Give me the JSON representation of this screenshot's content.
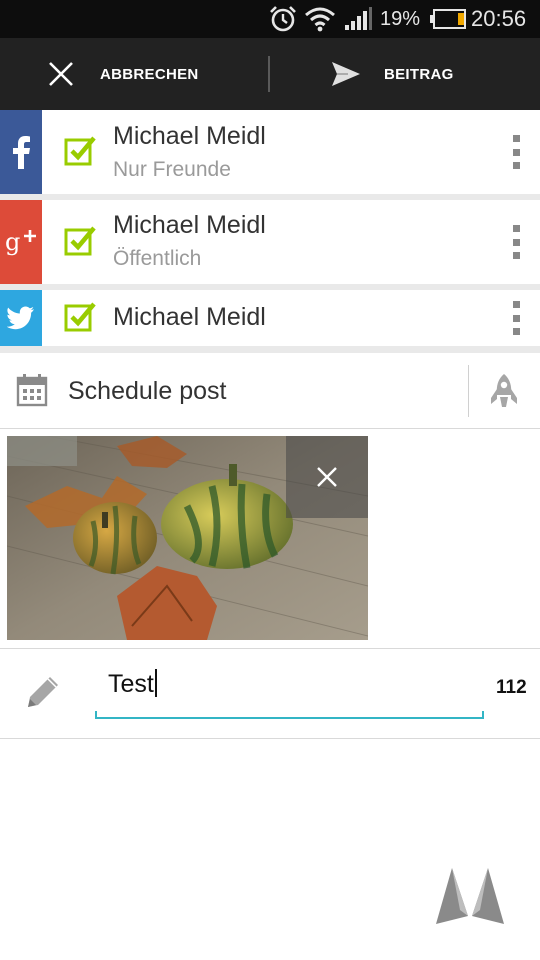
{
  "status_bar": {
    "icons": [
      "alarm-icon",
      "wifi-icon",
      "signal-icon"
    ],
    "battery_percent": "19%",
    "battery_level": 0.19,
    "time": "20:56"
  },
  "action_bar": {
    "cancel_label": "ABBRECHEN",
    "cancel_icon": "close-icon",
    "post_label": "BEITRAG",
    "post_icon": "send-icon"
  },
  "accounts": [
    {
      "network": "facebook",
      "network_icon": "facebook-icon",
      "color": "#3b5998",
      "checked": true,
      "name": "Michael Meidl",
      "audience": "Nur Freunde"
    },
    {
      "network": "google-plus",
      "network_icon": "google-plus-icon",
      "color": "#dd4b39",
      "checked": true,
      "name": "Michael Meidl",
      "audience": "Öffentlich"
    },
    {
      "network": "twitter",
      "network_icon": "twitter-icon",
      "color": "#2ea7e0",
      "checked": true,
      "name": "Michael Meidl"
    }
  ],
  "schedule": {
    "label": "Schedule post",
    "icon": "calendar-icon",
    "action_icon": "rocket-icon"
  },
  "attachment": {
    "type": "photo",
    "remove_icon": "close-icon"
  },
  "compose": {
    "icon": "pencil-icon",
    "text": "Test",
    "accent_color": "#33b5c5",
    "remaining_chars": "112"
  },
  "check_color": "#99cc00"
}
